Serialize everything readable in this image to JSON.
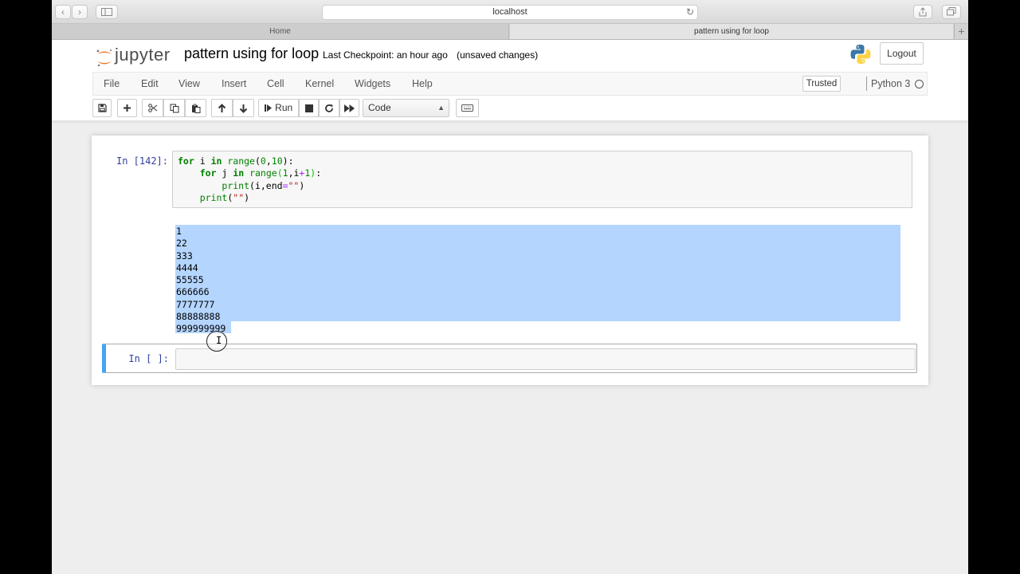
{
  "browser": {
    "url": "localhost",
    "tabs": [
      {
        "label": "Home",
        "active": false
      },
      {
        "label": "pattern using for loop",
        "active": true
      }
    ]
  },
  "header": {
    "logo_text": "jupyter",
    "notebook_name": "pattern using for loop",
    "checkpoint": "Last Checkpoint: an hour ago",
    "autosave": "(unsaved changes)",
    "logout_label": "Logout"
  },
  "menubar": {
    "items": [
      "File",
      "Edit",
      "View",
      "Insert",
      "Cell",
      "Kernel",
      "Widgets",
      "Help"
    ],
    "trusted_label": "Trusted",
    "kernel_name": "Python 3"
  },
  "toolbar": {
    "run_label": "Run",
    "cell_type": "Code",
    "icons": [
      "save-icon",
      "plus-icon",
      "cut-icon",
      "copy-icon",
      "paste-icon",
      "arrow-up-icon",
      "arrow-down-icon",
      "run-icon",
      "stop-icon",
      "restart-icon",
      "fast-forward-icon",
      "keyboard-icon"
    ]
  },
  "cells": [
    {
      "prompt": "In [142]:",
      "code": [
        "for i in range(0,10):",
        "    for j in range(1,i+1):",
        "        print(i,end=\"\")",
        "    print(\"\")"
      ],
      "output": [
        "1",
        "22",
        "333",
        "4444",
        "55555",
        "666666",
        "7777777",
        "88888888",
        "999999999"
      ]
    },
    {
      "prompt": "In [ ]:",
      "code": []
    }
  ],
  "colors": {
    "selection": "#b4d5fe",
    "active_cell_border": "#42a5f5",
    "prompt": "#303f9f",
    "keyword": "#008000"
  }
}
